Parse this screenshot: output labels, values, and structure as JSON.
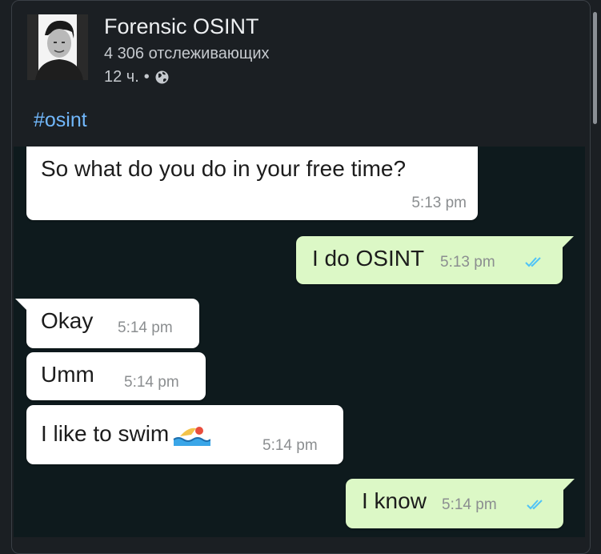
{
  "post": {
    "author": "Forensic OSINT",
    "followers": "4 306 отслеживающих",
    "time": "12 ч.",
    "dot": "•",
    "hashtag": "#osint"
  },
  "messages": [
    {
      "direction": "incoming",
      "text": "So what do you do in your free time?",
      "time": "5:13 pm"
    },
    {
      "direction": "outgoing",
      "text": "I do OSINT",
      "time": "5:13 pm",
      "status": "read-double-tick"
    },
    {
      "direction": "incoming",
      "text": "Okay",
      "time": "5:14 pm"
    },
    {
      "direction": "incoming",
      "text": "Umm",
      "time": "5:14 pm"
    },
    {
      "direction": "incoming",
      "text": "I like to swim",
      "time": "5:14 pm",
      "emoji": "swimmer-emoji"
    },
    {
      "direction": "outgoing",
      "text": "I know",
      "time": "5:14 pm",
      "status": "read-double-tick"
    }
  ],
  "colors": {
    "background": "#1b1f23",
    "chat_background": "#0e1a1d",
    "incoming_bubble": "#ffffff",
    "outgoing_bubble": "#dcf8c6",
    "hashtag": "#71b7fb",
    "read_tick": "#4fc3f7"
  },
  "icons": [
    "globe-icon",
    "double-check-icon",
    "swimmer-emoji"
  ]
}
